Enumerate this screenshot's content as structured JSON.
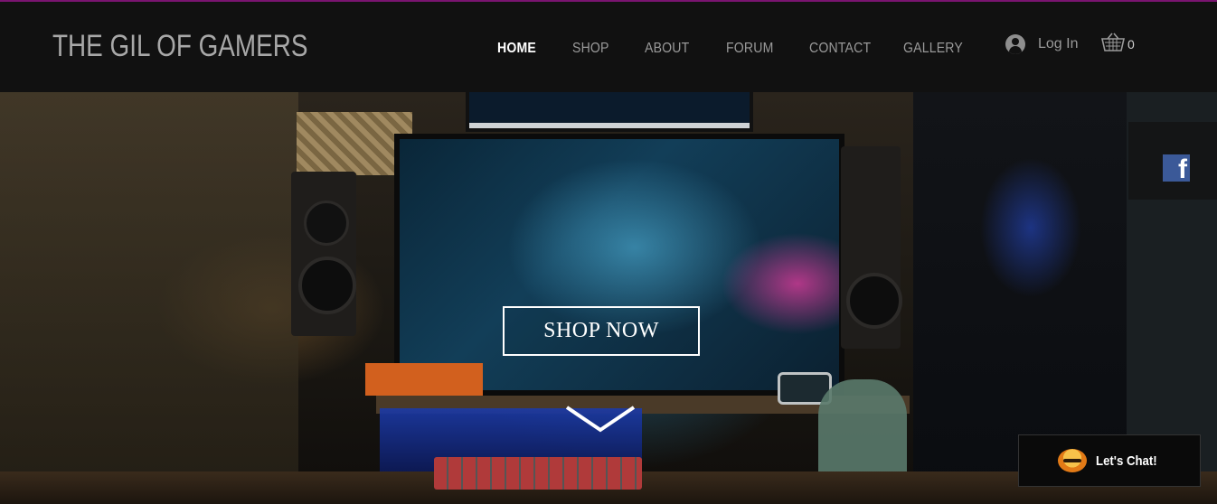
{
  "header": {
    "brand": "THE GIL OF GAMERS",
    "nav": [
      {
        "label": "HOME",
        "active": true
      },
      {
        "label": "SHOP",
        "active": false
      },
      {
        "label": "ABOUT",
        "active": false
      },
      {
        "label": "FORUM",
        "active": false
      },
      {
        "label": "CONTACT",
        "active": false
      },
      {
        "label": "GALLERY",
        "active": false
      }
    ],
    "login_label": "Log In",
    "cart_count": "0",
    "icons": {
      "login": "user-avatar-icon",
      "cart": "shopping-basket-icon"
    }
  },
  "hero": {
    "cta_label": "SHOP NOW",
    "scroll_icon": "chevron-down-icon"
  },
  "social": {
    "facebook_glyph": "f"
  },
  "chat": {
    "label": "Let's Chat!"
  },
  "colors": {
    "accent_line": "#7a1470",
    "header_bg": "#111111",
    "facebook": "#3b5998"
  }
}
